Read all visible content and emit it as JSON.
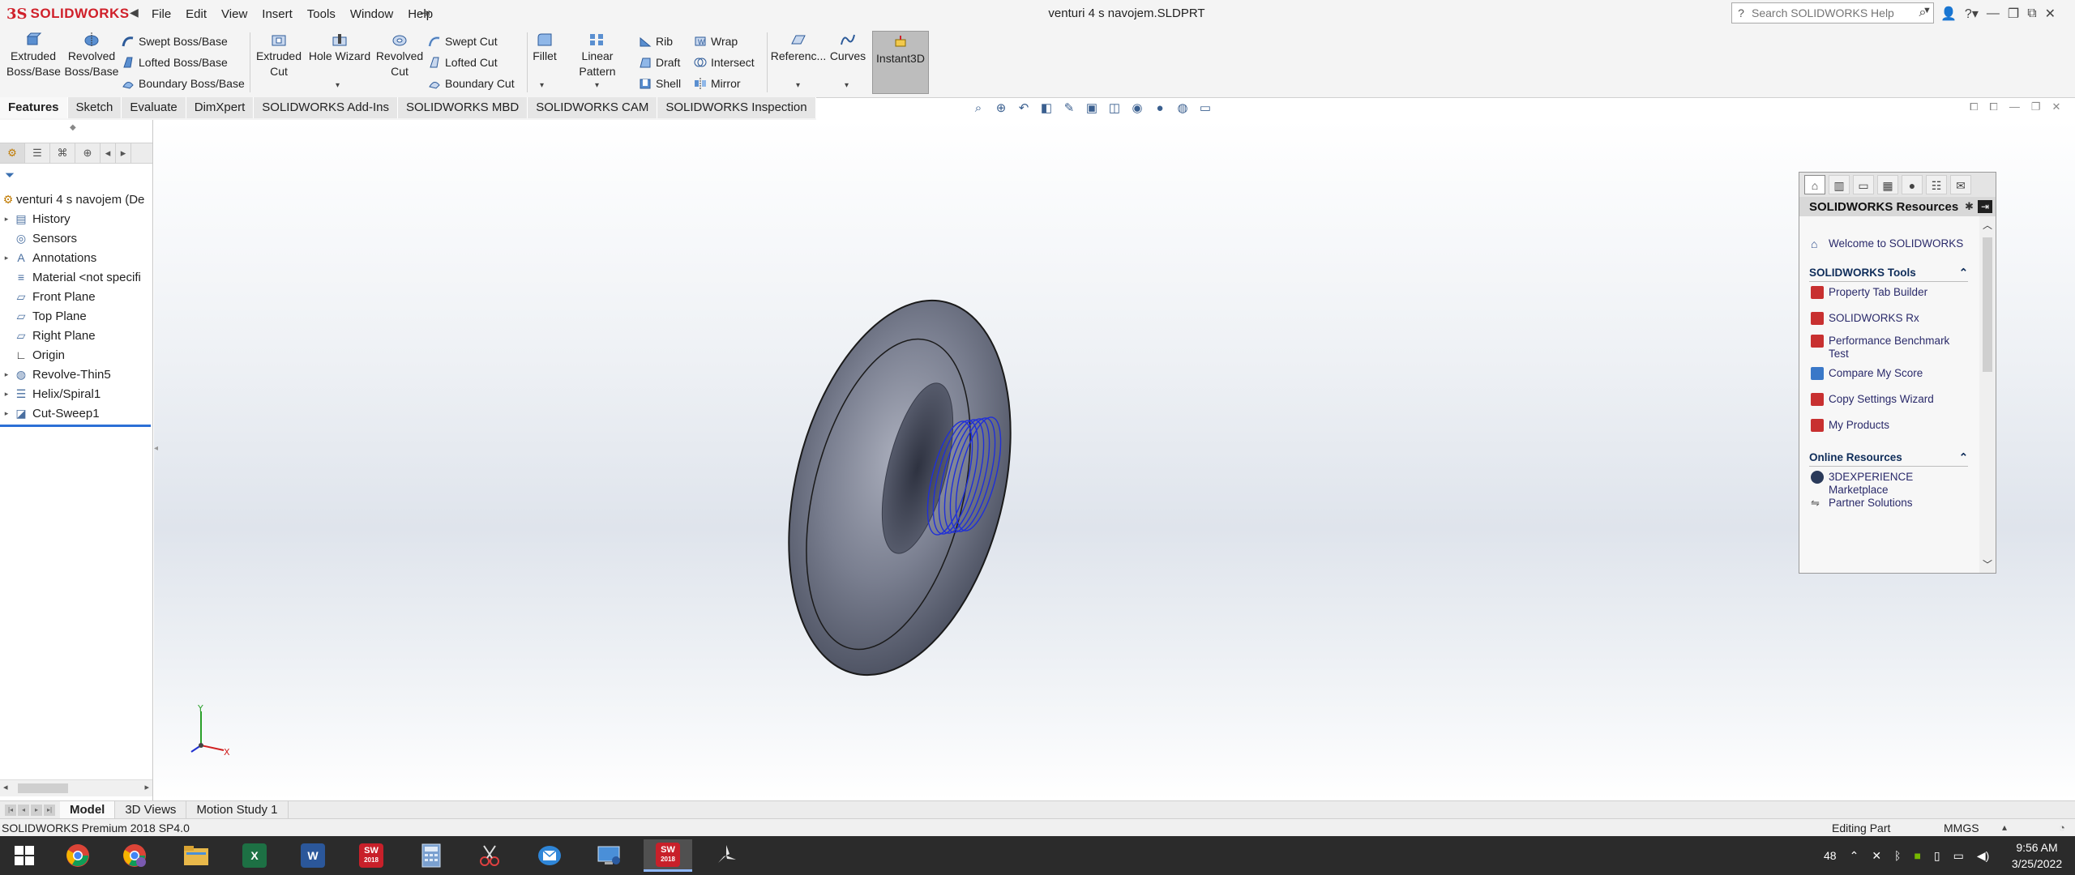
{
  "titlebar": {
    "logo_ds": "3S",
    "logo_name": "SOLIDWORKS",
    "menu": [
      "File",
      "Edit",
      "View",
      "Insert",
      "Tools",
      "Window",
      "Help"
    ],
    "document_title": "venturi 4 s navojem.SLDPRT",
    "search_placeholder": "Search SOLIDWORKS Help",
    "icons": [
      "user-icon",
      "help-icon",
      "minimize-icon",
      "restore-icon",
      "maximize-icon",
      "close-icon"
    ]
  },
  "command_manager": {
    "extruded_boss": [
      "Extruded",
      "Boss/Base"
    ],
    "revolved_boss": [
      "Revolved",
      "Boss/Base"
    ],
    "swept_boss": "Swept Boss/Base",
    "lofted_boss": "Lofted Boss/Base",
    "boundary_boss": "Boundary Boss/Base",
    "extruded_cut": [
      "Extruded",
      "Cut"
    ],
    "hole_wizard": "Hole Wizard",
    "revolved_cut": [
      "Revolved",
      "Cut"
    ],
    "swept_cut": "Swept Cut",
    "lofted_cut": "Lofted Cut",
    "boundary_cut": "Boundary Cut",
    "fillet": "Fillet",
    "linear_pattern": "Linear Pattern",
    "rib": "Rib",
    "draft": "Draft",
    "shell": "Shell",
    "wrap": "Wrap",
    "intersect": "Intersect",
    "mirror": "Mirror",
    "reference": "Referenc...",
    "curves": "Curves",
    "instant3d": "Instant3D"
  },
  "tabs": [
    "Features",
    "Sketch",
    "Evaluate",
    "DimXpert",
    "SOLIDWORKS Add-Ins",
    "SOLIDWORKS MBD",
    "SOLIDWORKS CAM",
    "SOLIDWORKS Inspection"
  ],
  "feature_tree": {
    "root": "venturi 4 s navojem  (De",
    "items": [
      {
        "label": "History",
        "expand": true
      },
      {
        "label": "Sensors",
        "expand": false
      },
      {
        "label": "Annotations",
        "expand": true
      },
      {
        "label": "Material <not specifi",
        "expand": false
      },
      {
        "label": "Front Plane",
        "expand": false
      },
      {
        "label": "Top Plane",
        "expand": false
      },
      {
        "label": "Right Plane",
        "expand": false
      },
      {
        "label": "Origin",
        "expand": false
      },
      {
        "label": "Revolve-Thin5",
        "expand": true
      },
      {
        "label": "Helix/Spiral1",
        "expand": true
      },
      {
        "label": "Cut-Sweep1",
        "expand": true
      }
    ]
  },
  "bottom_tabs": [
    "Model",
    "3D Views",
    "Motion Study 1"
  ],
  "status": {
    "product": "SOLIDWORKS Premium 2018 SP4.0",
    "editing": "Editing Part",
    "units": "MMGS"
  },
  "task_pane": {
    "title": "SOLIDWORKS Resources",
    "welcome": "Welcome to SOLIDWORKS",
    "tools_header": "SOLIDWORKS Tools",
    "tools": [
      "Property Tab Builder",
      "SOLIDWORKS Rx",
      "Performance Benchmark Test",
      "Compare My Score",
      "Copy Settings Wizard",
      "My Products"
    ],
    "online_header": "Online Resources",
    "online": [
      "3DEXPERIENCE Marketplace",
      "Partner Solutions"
    ]
  },
  "taskbar": {
    "apps": [
      "windows-start",
      "chrome",
      "chrome-profile",
      "file-explorer",
      "excel",
      "word",
      "solidworks-2018",
      "calculator",
      "snipping-tool",
      "outlook",
      "remote-desktop",
      "solidworks-2018-active",
      "pinwheel"
    ],
    "sw_badge": "2018",
    "tray_temp": "48",
    "time": "9:56 AM",
    "date": "3/25/2022"
  },
  "colors": {
    "accent": "#d0202a",
    "selection_blue": "#2c6fd6",
    "model_gray": "#6e7384",
    "thread_blue": "#1f2fd8"
  }
}
